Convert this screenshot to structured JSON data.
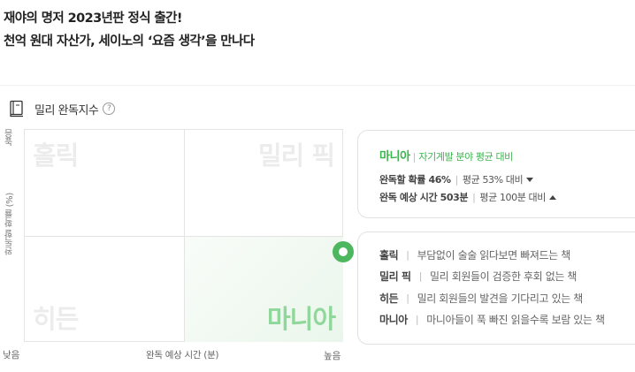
{
  "headline": {
    "line1": "재야의 명저 2023년판 정식 출간!",
    "line2": "천억 원대 자산가, 세이노의 ‘요즘 생각’을 만나다"
  },
  "section": {
    "icon": "book-icon",
    "title": "밀리 완독지수",
    "help_icon": "question-icon",
    "help_glyph": "?"
  },
  "chart": {
    "quadrants": {
      "top_left": "홀릭",
      "top_right": "밀리 픽",
      "bottom_left": "히든",
      "bottom_right": "마니아"
    },
    "highlighted_quadrant": "마니아",
    "y_axis": {
      "label": "완독할 확률 (%)",
      "high": "높음"
    },
    "x_axis": {
      "label": "완독 예상 시간 (분)",
      "low": "낮음",
      "high": "높음"
    },
    "marker": {
      "quadrant": "마니아",
      "completion_rate_pct": 46,
      "reading_time_min": 503
    },
    "colors": {
      "accent": "#3bb44f",
      "highlight_text": "#8fd79b"
    }
  },
  "summary": {
    "category": "마니아",
    "separator": "|",
    "subtitle": "자기계발 분야 평균 대비",
    "completion_label": "완독할 확률 46%",
    "completion_avg": "평균 53% 대비",
    "completion_trend": "down",
    "time_label": "완독 예상 시간 503분",
    "time_avg": "평균 100분 대비",
    "time_trend": "up"
  },
  "legend": [
    {
      "name": "홀릭",
      "desc": "부담없이 술술 읽다보면 빠져드는 책"
    },
    {
      "name": "밀리 픽",
      "desc": "밀리 회원들이 검증한 후회 없는 책"
    },
    {
      "name": "히든",
      "desc": "밀리 회원들의 발견을 기다리고 있는 책"
    },
    {
      "name": "마니아",
      "desc": "마니아들이 푹 빠진 읽을수록 보람 있는 책"
    }
  ]
}
